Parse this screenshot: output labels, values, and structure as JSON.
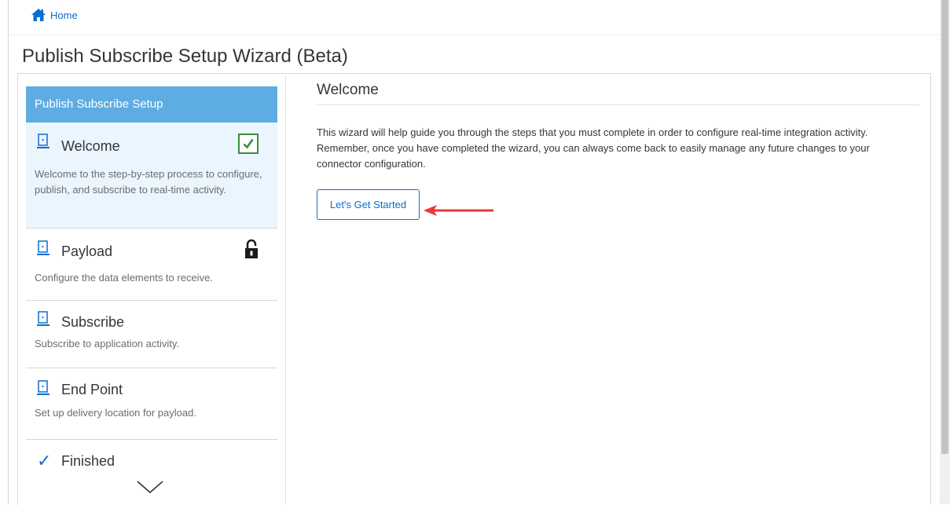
{
  "breadcrumb": {
    "home_label": "Home",
    "icon": "home-icon"
  },
  "page": {
    "title": "Publish Subscribe Setup Wizard (Beta)"
  },
  "wizard_nav": {
    "header": "Publish Subscribe Setup",
    "steps": [
      {
        "title": "Welcome",
        "description": "Welcome to the step-by-step process to configure, publish, and subscribe to real-time activity.",
        "status": "completed",
        "icon": "step-tablet-icon"
      },
      {
        "title": "Payload",
        "description": "Configure the data elements to receive.",
        "status": "locked",
        "icon": "step-tablet-icon"
      },
      {
        "title": "Subscribe",
        "description": "Subscribe to application activity.",
        "status": "pending",
        "icon": "step-tablet-icon"
      },
      {
        "title": "End Point",
        "description": "Set up delivery location for payload.",
        "status": "pending",
        "icon": "step-tablet-icon"
      },
      {
        "title": "Finished",
        "description": "",
        "status": "final",
        "icon": "checkmark-icon"
      }
    ]
  },
  "content": {
    "title": "Welcome",
    "body": "This wizard will help guide you through the steps that you must complete in order to configure real-time integration activity. Remember, once you have completed the wizard, you can always come back to easily manage any future changes to your connector configuration.",
    "start_button_label": "Let's Get Started"
  },
  "colors": {
    "accent": "#0a6ed1",
    "header_bg": "#5dade2",
    "active_step_bg": "#ebf5fe",
    "check_green": "#3c8a3a",
    "annotation_arrow": "#e8383d"
  }
}
